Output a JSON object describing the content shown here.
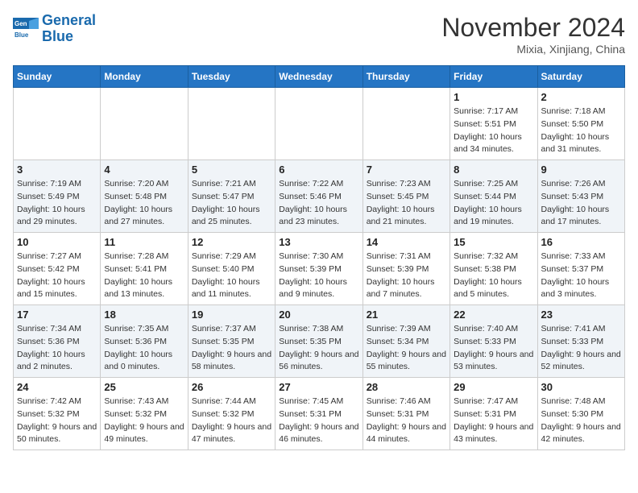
{
  "header": {
    "logo_line1": "General",
    "logo_line2": "Blue",
    "month_title": "November 2024",
    "location": "Mixia, Xinjiang, China"
  },
  "days_of_week": [
    "Sunday",
    "Monday",
    "Tuesday",
    "Wednesday",
    "Thursday",
    "Friday",
    "Saturday"
  ],
  "weeks": [
    [
      {
        "day": "",
        "info": ""
      },
      {
        "day": "",
        "info": ""
      },
      {
        "day": "",
        "info": ""
      },
      {
        "day": "",
        "info": ""
      },
      {
        "day": "",
        "info": ""
      },
      {
        "day": "1",
        "info": "Sunrise: 7:17 AM\nSunset: 5:51 PM\nDaylight: 10 hours and 34 minutes."
      },
      {
        "day": "2",
        "info": "Sunrise: 7:18 AM\nSunset: 5:50 PM\nDaylight: 10 hours and 31 minutes."
      }
    ],
    [
      {
        "day": "3",
        "info": "Sunrise: 7:19 AM\nSunset: 5:49 PM\nDaylight: 10 hours and 29 minutes."
      },
      {
        "day": "4",
        "info": "Sunrise: 7:20 AM\nSunset: 5:48 PM\nDaylight: 10 hours and 27 minutes."
      },
      {
        "day": "5",
        "info": "Sunrise: 7:21 AM\nSunset: 5:47 PM\nDaylight: 10 hours and 25 minutes."
      },
      {
        "day": "6",
        "info": "Sunrise: 7:22 AM\nSunset: 5:46 PM\nDaylight: 10 hours and 23 minutes."
      },
      {
        "day": "7",
        "info": "Sunrise: 7:23 AM\nSunset: 5:45 PM\nDaylight: 10 hours and 21 minutes."
      },
      {
        "day": "8",
        "info": "Sunrise: 7:25 AM\nSunset: 5:44 PM\nDaylight: 10 hours and 19 minutes."
      },
      {
        "day": "9",
        "info": "Sunrise: 7:26 AM\nSunset: 5:43 PM\nDaylight: 10 hours and 17 minutes."
      }
    ],
    [
      {
        "day": "10",
        "info": "Sunrise: 7:27 AM\nSunset: 5:42 PM\nDaylight: 10 hours and 15 minutes."
      },
      {
        "day": "11",
        "info": "Sunrise: 7:28 AM\nSunset: 5:41 PM\nDaylight: 10 hours and 13 minutes."
      },
      {
        "day": "12",
        "info": "Sunrise: 7:29 AM\nSunset: 5:40 PM\nDaylight: 10 hours and 11 minutes."
      },
      {
        "day": "13",
        "info": "Sunrise: 7:30 AM\nSunset: 5:39 PM\nDaylight: 10 hours and 9 minutes."
      },
      {
        "day": "14",
        "info": "Sunrise: 7:31 AM\nSunset: 5:39 PM\nDaylight: 10 hours and 7 minutes."
      },
      {
        "day": "15",
        "info": "Sunrise: 7:32 AM\nSunset: 5:38 PM\nDaylight: 10 hours and 5 minutes."
      },
      {
        "day": "16",
        "info": "Sunrise: 7:33 AM\nSunset: 5:37 PM\nDaylight: 10 hours and 3 minutes."
      }
    ],
    [
      {
        "day": "17",
        "info": "Sunrise: 7:34 AM\nSunset: 5:36 PM\nDaylight: 10 hours and 2 minutes."
      },
      {
        "day": "18",
        "info": "Sunrise: 7:35 AM\nSunset: 5:36 PM\nDaylight: 10 hours and 0 minutes."
      },
      {
        "day": "19",
        "info": "Sunrise: 7:37 AM\nSunset: 5:35 PM\nDaylight: 9 hours and 58 minutes."
      },
      {
        "day": "20",
        "info": "Sunrise: 7:38 AM\nSunset: 5:35 PM\nDaylight: 9 hours and 56 minutes."
      },
      {
        "day": "21",
        "info": "Sunrise: 7:39 AM\nSunset: 5:34 PM\nDaylight: 9 hours and 55 minutes."
      },
      {
        "day": "22",
        "info": "Sunrise: 7:40 AM\nSunset: 5:33 PM\nDaylight: 9 hours and 53 minutes."
      },
      {
        "day": "23",
        "info": "Sunrise: 7:41 AM\nSunset: 5:33 PM\nDaylight: 9 hours and 52 minutes."
      }
    ],
    [
      {
        "day": "24",
        "info": "Sunrise: 7:42 AM\nSunset: 5:32 PM\nDaylight: 9 hours and 50 minutes."
      },
      {
        "day": "25",
        "info": "Sunrise: 7:43 AM\nSunset: 5:32 PM\nDaylight: 9 hours and 49 minutes."
      },
      {
        "day": "26",
        "info": "Sunrise: 7:44 AM\nSunset: 5:32 PM\nDaylight: 9 hours and 47 minutes."
      },
      {
        "day": "27",
        "info": "Sunrise: 7:45 AM\nSunset: 5:31 PM\nDaylight: 9 hours and 46 minutes."
      },
      {
        "day": "28",
        "info": "Sunrise: 7:46 AM\nSunset: 5:31 PM\nDaylight: 9 hours and 44 minutes."
      },
      {
        "day": "29",
        "info": "Sunrise: 7:47 AM\nSunset: 5:31 PM\nDaylight: 9 hours and 43 minutes."
      },
      {
        "day": "30",
        "info": "Sunrise: 7:48 AM\nSunset: 5:30 PM\nDaylight: 9 hours and 42 minutes."
      }
    ]
  ]
}
